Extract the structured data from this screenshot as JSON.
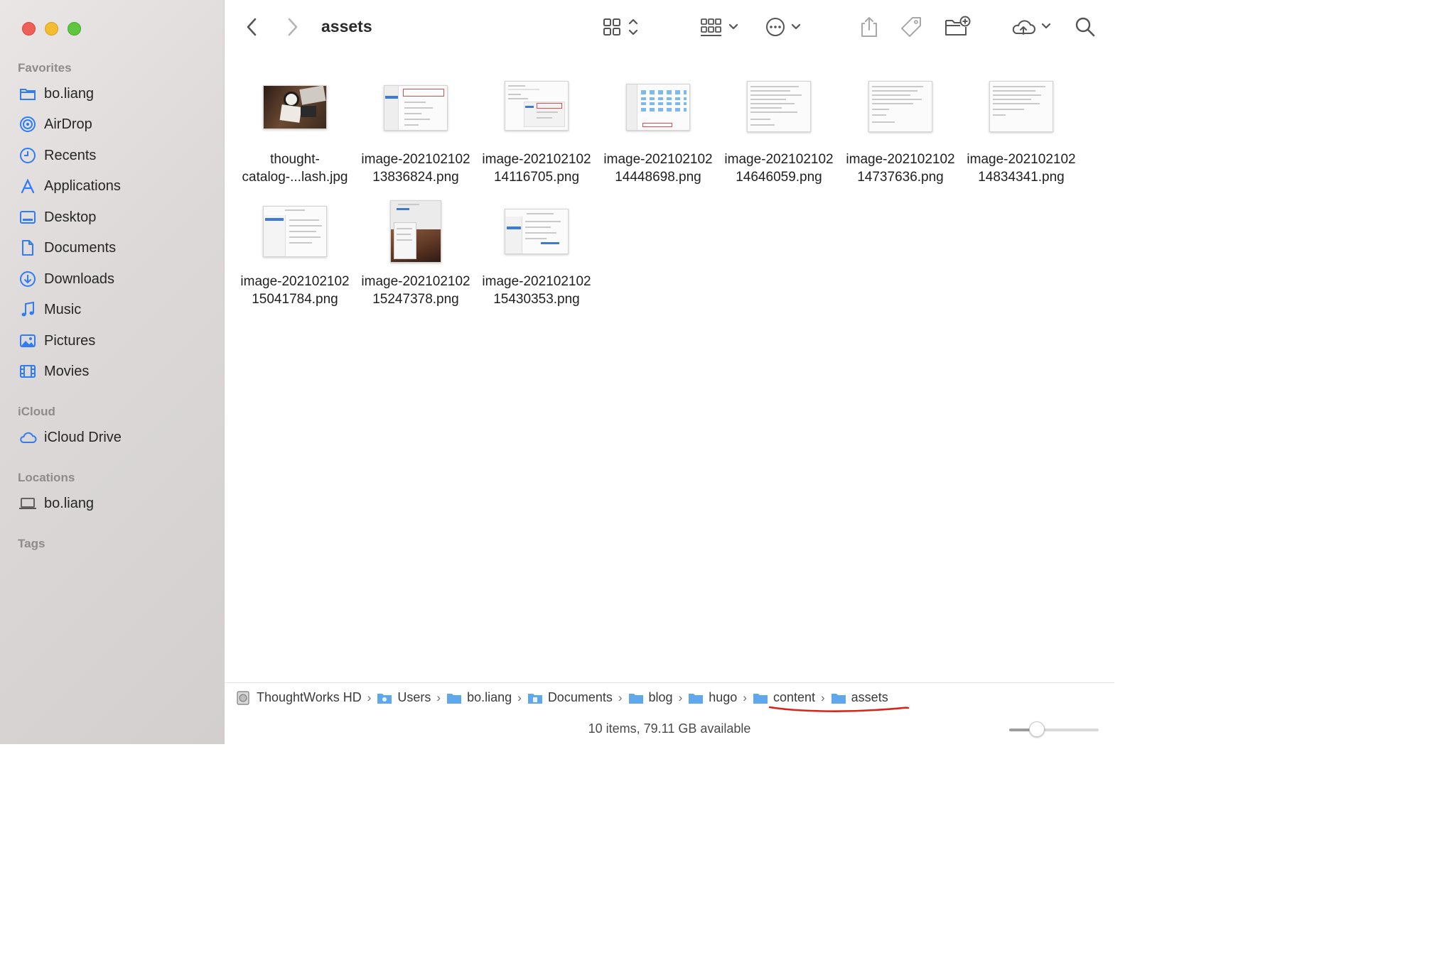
{
  "window": {
    "title": "assets"
  },
  "sidebar": {
    "sections": [
      {
        "label": "Favorites",
        "items": [
          {
            "label": "bo.liang",
            "icon": "home-folder-icon"
          },
          {
            "label": "AirDrop",
            "icon": "airdrop-icon"
          },
          {
            "label": "Recents",
            "icon": "clock-icon"
          },
          {
            "label": "Applications",
            "icon": "applications-icon"
          },
          {
            "label": "Desktop",
            "icon": "desktop-icon"
          },
          {
            "label": "Documents",
            "icon": "document-icon"
          },
          {
            "label": "Downloads",
            "icon": "download-icon"
          },
          {
            "label": "Music",
            "icon": "music-note-icon"
          },
          {
            "label": "Pictures",
            "icon": "photo-icon"
          },
          {
            "label": "Movies",
            "icon": "film-icon"
          }
        ]
      },
      {
        "label": "iCloud",
        "items": [
          {
            "label": "iCloud Drive",
            "icon": "cloud-icon"
          }
        ]
      },
      {
        "label": "Locations",
        "items": [
          {
            "label": "bo.liang",
            "icon": "laptop-icon"
          }
        ]
      },
      {
        "label": "Tags",
        "items": []
      }
    ]
  },
  "toolbar": {
    "back_icon": "chevron-left-icon",
    "forward_icon": "chevron-right-icon",
    "view_icon": "icon-grid-view-icon",
    "group_icon": "group-by-icon",
    "action_icon": "ellipsis-circle-icon",
    "share_icon": "share-icon",
    "tag_icon": "tag-icon",
    "new_folder_icon": "new-folder-icon",
    "icloud_icon": "cloud-upload-icon",
    "search_icon": "search-icon"
  },
  "files": [
    {
      "line1": "thought-",
      "line2": "catalog-...lash.jpg",
      "kind": "photo"
    },
    {
      "line1": "image-202102102",
      "line2": "13836824.png",
      "kind": "dialog"
    },
    {
      "line1": "image-202102102",
      "line2": "14116705.png",
      "kind": "sidebar-doc"
    },
    {
      "line1": "image-202102102",
      "line2": "14448698.png",
      "kind": "folder-grid"
    },
    {
      "line1": "image-202102102",
      "line2": "14646059.png",
      "kind": "text-doc"
    },
    {
      "line1": "image-202102102",
      "line2": "14737636.png",
      "kind": "text-doc"
    },
    {
      "line1": "image-202102102",
      "line2": "14834341.png",
      "kind": "text-doc"
    },
    {
      "line1": "image-202102102",
      "line2": "15041784.png",
      "kind": "settings"
    },
    {
      "line1": "image-202102102",
      "line2": "15247378.png",
      "kind": "menu-photo"
    },
    {
      "line1": "image-202102102",
      "line2": "15430353.png",
      "kind": "prefs"
    }
  ],
  "path": [
    {
      "label": "ThoughtWorks HD",
      "icon": "hard-drive-icon"
    },
    {
      "label": "Users",
      "icon": "users-folder-icon"
    },
    {
      "label": "bo.liang",
      "icon": "home-folder-icon"
    },
    {
      "label": "Documents",
      "icon": "documents-folder-icon"
    },
    {
      "label": "blog",
      "icon": "folder-icon"
    },
    {
      "label": "hugo",
      "icon": "folder-icon"
    },
    {
      "label": "content",
      "icon": "folder-icon"
    },
    {
      "label": "assets",
      "icon": "folder-icon"
    }
  ],
  "status": {
    "text": "10 items, 79.11 GB available",
    "icon_size_level": 0.27
  },
  "colors": {
    "accent": "#2f7cf6",
    "annotation": "#d9241b",
    "folder": "#5fa8ee"
  }
}
